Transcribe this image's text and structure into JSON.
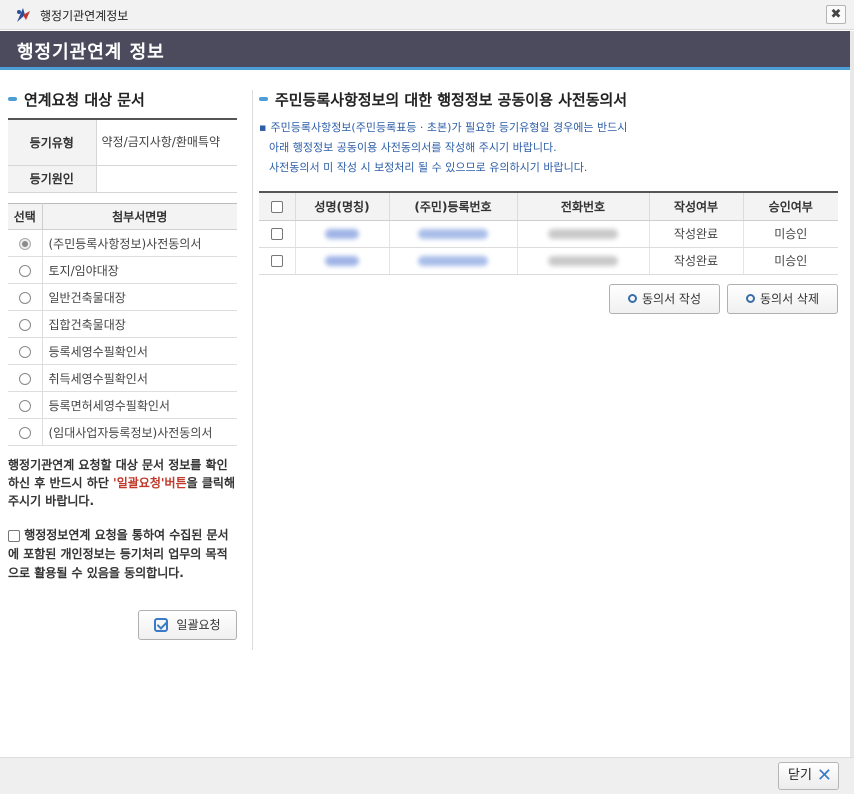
{
  "window": {
    "title": "행정기관연계정보",
    "close_symbol": "✖"
  },
  "header": {
    "title": "행정기관연계 정보"
  },
  "left": {
    "section_title": "연계요청 대상 문서",
    "info": [
      {
        "label": "등기유형",
        "value": "약정/금지사항/환매특약"
      },
      {
        "label": "등기원인",
        "value": ""
      }
    ],
    "doc_table": {
      "headers": [
        "선택",
        "첨부서면명"
      ],
      "rows": [
        {
          "name": "(주민등록사항정보)사전동의서",
          "selected": true
        },
        {
          "name": "토지/임야대장",
          "selected": false
        },
        {
          "name": "일반건축물대장",
          "selected": false
        },
        {
          "name": "집합건축물대장",
          "selected": false
        },
        {
          "name": "등록세영수필확인서",
          "selected": false
        },
        {
          "name": "취득세영수필확인서",
          "selected": false
        },
        {
          "name": "등록면허세영수필확인서",
          "selected": false
        },
        {
          "name": "(임대사업자등록정보)사전동의서",
          "selected": false
        }
      ]
    },
    "notice_pre": "행정기관연계 요청할 대상 문서 정보를 확인하신 후 반드시 하단 ",
    "notice_highlight": "'일괄요청'버튼",
    "notice_post": "을 클릭해 주시기 바랍니다.",
    "agree_text": "행정정보연계 요청을 통하여 수집된 문서에 포함된 개인정보는 등기처리 업무의 목적으로 활용될 수 있음을 동의합니다.",
    "batch_button": "일괄요청"
  },
  "right": {
    "section_title": "주민등록사항정보의 대한 행정정보 공동이용 사전동의서",
    "desc_bullet": "▪",
    "desc_line1": "주민등록사항정보(주민등록표등 · 초본)가 필요한 등기유형일 경우에는 반드시",
    "desc_line2": "아래 행정정보 공동이용 사전동의서를 작성해 주시기 바랍니다.",
    "desc_line3": "사전동의서 미 작성 시 보정처리 될 수 있으므로 유의하시기 바랍니다.",
    "table": {
      "headers": [
        "성명(명칭)",
        "(주민)등록번호",
        "전화번호",
        "작성여부",
        "승인여부"
      ],
      "rows": [
        {
          "status": "작성완료",
          "approval": "미승인"
        },
        {
          "status": "작성완료",
          "approval": "미승인"
        }
      ]
    },
    "write_button": "동의서 작성",
    "delete_button": "동의서 삭제"
  },
  "footer": {
    "close_label": "닫기",
    "close_symbol": "✕"
  },
  "colors": {
    "header_bg": "#4c4b5e",
    "accent": "#4d9ed6",
    "desc_text": "#2d5ea8",
    "highlight": "#c0392b"
  }
}
